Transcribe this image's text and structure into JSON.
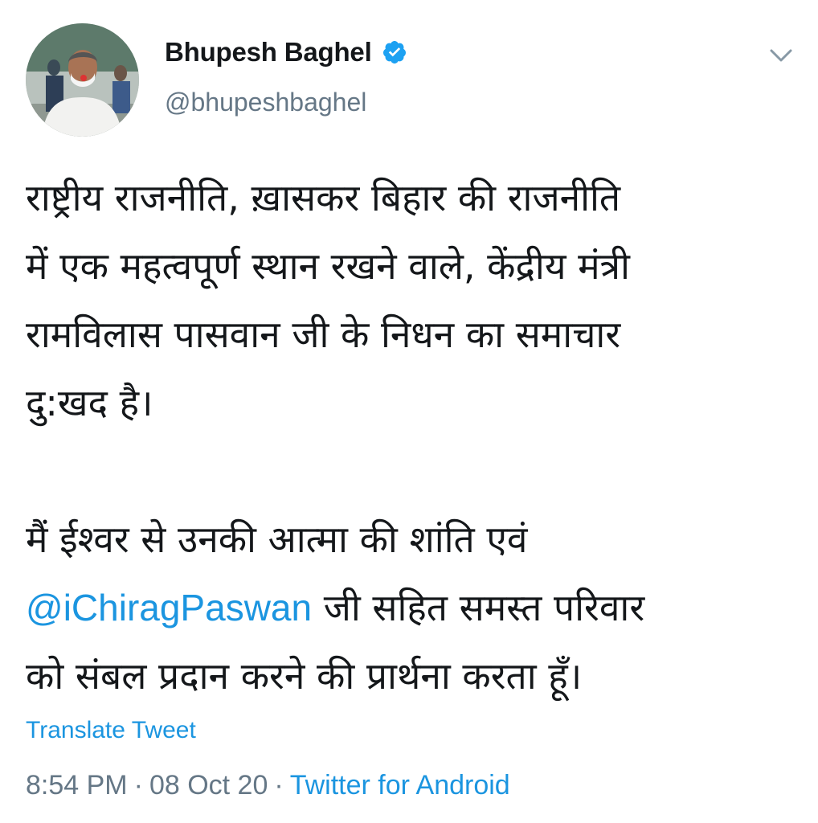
{
  "tweet": {
    "author": {
      "display_name": "Bhupesh Baghel",
      "handle": "@bhupeshbaghel",
      "verified": true
    },
    "body": {
      "paragraph1": "राष्ट्रीय राजनीति, ख़ासकर  बिहार की राजनीति\nमें एक महत्वपूर्ण स्थान रखने वाले, केंद्रीय मंत्री\nरामविलास पासवान जी के निधन का समाचार\nदु:खद है।",
      "paragraph2_line1": "मैं ईश्वर से उनकी आत्मा की शांति एवं",
      "mention": "@iChiragPaswan",
      "paragraph2_rest": " जी सहित समस्त परिवार\nको संबल प्रदान करने की प्रार्थना करता हूँ।"
    },
    "translate_label": "Translate Tweet",
    "time": "8:54 PM",
    "date": "08 Oct 20",
    "source": "Twitter for Android",
    "separator": "·"
  },
  "colors": {
    "link": "#1b95e0",
    "secondary_text": "#657786",
    "primary_text": "#14171a",
    "verified_badge": "#1da1f2"
  },
  "icons": {
    "verified": "verified-badge-icon",
    "menu": "chevron-down-icon"
  }
}
